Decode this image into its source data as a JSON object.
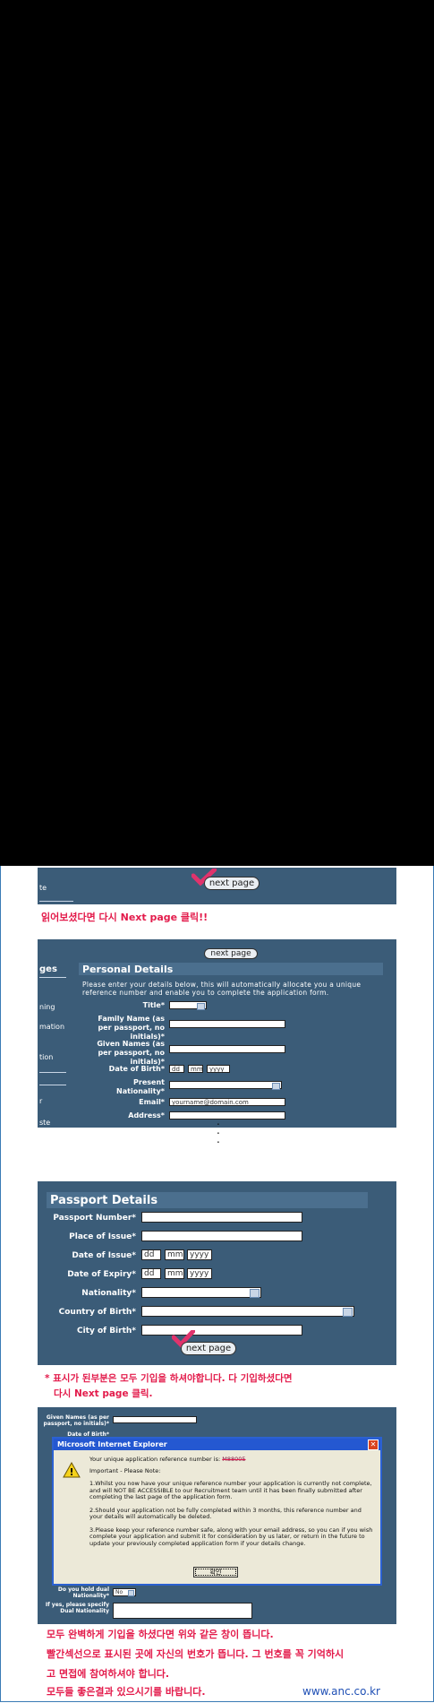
{
  "colors": {
    "panel": "#3b5c78",
    "accent_red": "#e31b4b",
    "link_blue": "#2050b5"
  },
  "step1": {
    "nav_label": "te",
    "next_button": "next page",
    "caption": "읽어보셨다면 다시 Next page 클릭!!"
  },
  "step2": {
    "next_button": "next page",
    "section_title": "Personal Details",
    "nav_header": "ges",
    "side_items": [
      "ning",
      "mation",
      "tion",
      "r",
      "ste"
    ],
    "intro": "Please enter your details below, this will automatically allocate you a unique reference number and enable you to complete the application form.",
    "fields": {
      "title": "Title*",
      "family_name": "Family Name (as per passport, no initials)*",
      "given_names": "Given Names (as per passport, no initials)*",
      "dob": "Date of Birth*",
      "dob_dd": "dd",
      "dob_mm": "mm",
      "dob_yyyy": "yyyy",
      "nationality": "Present Nationality*",
      "email": "Email*",
      "email_value": "yourname@domain.com",
      "address": "Address*"
    }
  },
  "dots": ".\n.\n.",
  "step3": {
    "section_title": "Passport Details",
    "fields": {
      "passport_number": "Passport Number*",
      "place_of_issue": "Place of Issue*",
      "date_of_issue": "Date of Issue*",
      "date_of_expiry": "Date of Expiry*",
      "nationality": "Nationality*",
      "country_of_birth": "Country of Birth*",
      "city_of_birth": "City of Birth*",
      "dd": "dd",
      "mm": "mm",
      "yyyy": "yyyy"
    },
    "next_button": "next page",
    "caption_line1": "* 표시가 된부분은 모두 기입을 하셔야합니다. 다 기입하셨다면",
    "caption_line2": "다시 Next page 클릭."
  },
  "step4": {
    "bg_label1": "Given Names (as per passport, no initials)*",
    "bg_label2": "Date of Birth*",
    "dialog_title": "Microsoft Internet Explorer",
    "ref_line": "Your unique application reference number is:",
    "ref_number": "M88005",
    "important": "Important - Please Note:",
    "note1": "1.Whilst you now have your unique reference number your application is currently not complete, and will NOT BE ACCESSIBLE to our Recruitment team until it has been finally submitted after completing the last page of the application form.",
    "note2": "2.Should your application not be fully completed within 3 months, this reference number and your details will automatically be deleted.",
    "note3": "3.Please keep your reference number safe, along with your email address, so you can if you wish complete your application and submit it for consideration by us later, or return in the future to update your previously completed application form if your details change.",
    "ok_button": "확인",
    "dual_label": "Do you hold dual Nationality*",
    "dual_value": "No",
    "specify_label": "If yes, please specify Dual Nationality"
  },
  "footer": {
    "line1": "모두 완벽하게 기입을 하셨다면 위와 같은 창이 뜹니다.",
    "line2": "빨간섹선으로 표시된 곳에 자신의 번호가 뜹니다. 그 번호를 꼭 기억하시",
    "line3": "고 면접에 참여하셔야 합니다.",
    "line4": "모두들 좋은결과 있으시기를 바랍니다.",
    "site": "www.anc.co.kr"
  }
}
